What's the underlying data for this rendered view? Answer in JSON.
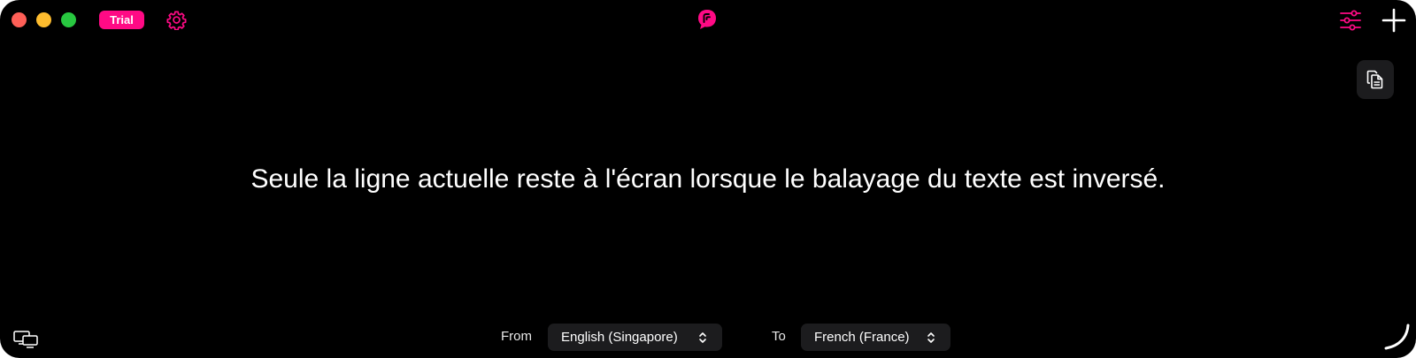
{
  "titlebar": {
    "badge_label": "Trial",
    "icons": {
      "settings": "gear-icon",
      "logo": "app-logo-icon",
      "filters": "sliders-icon",
      "add": "plus-icon"
    }
  },
  "colors": {
    "background": "#000000",
    "accent": "#ff0a85",
    "control_bg": "#1c1c1e",
    "close": "#fe5f57",
    "minimize": "#febc2e",
    "maximize": "#28c840"
  },
  "main": {
    "transcript": "Seule la ligne actuelle reste à l'écran lorsque le balayage du texte est inversé."
  },
  "footer": {
    "from_label": "From",
    "from_value": "English (Singapore)",
    "to_label": "To",
    "to_value": "French (France)"
  }
}
